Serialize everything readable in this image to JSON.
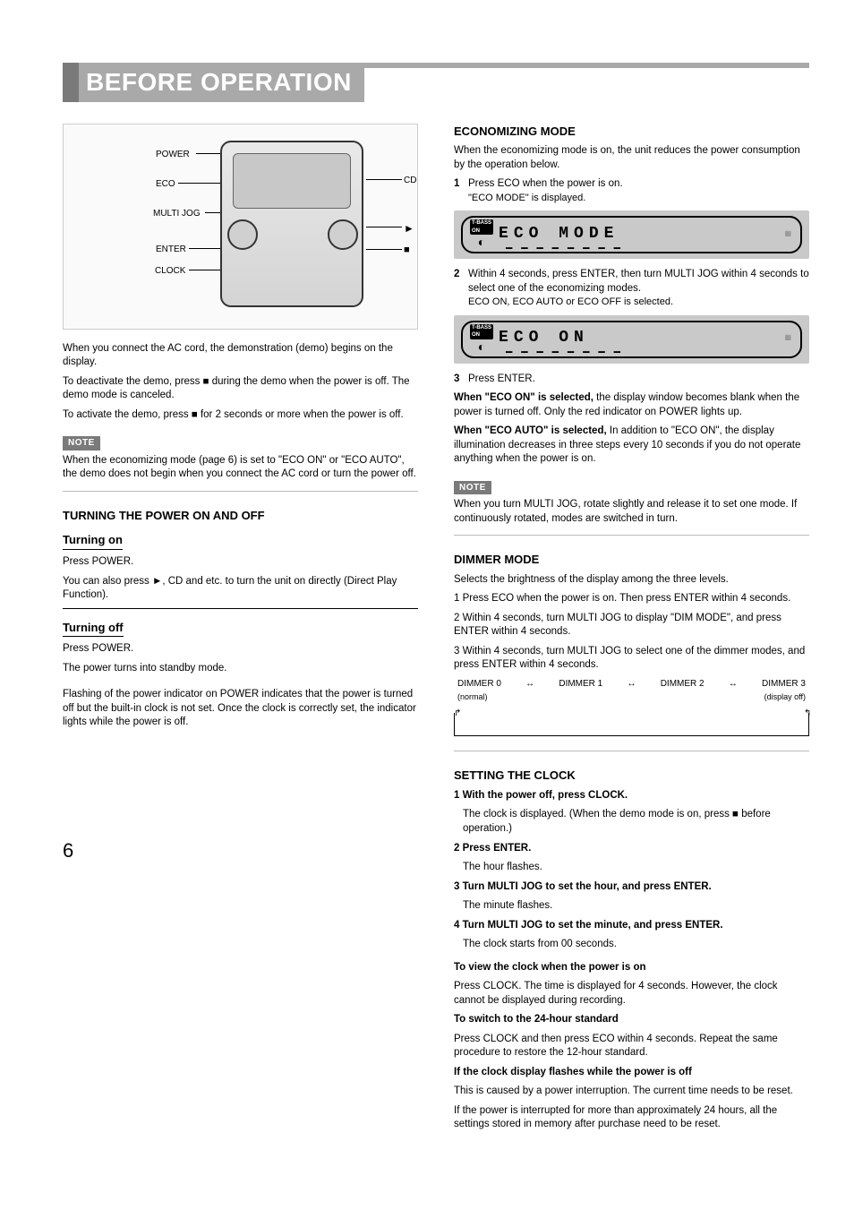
{
  "header": {
    "title": "BEFORE OPERATION"
  },
  "diagram": {
    "labels": {
      "power": "POWER",
      "eco": "ECO",
      "multijog": "MULTI JOG",
      "enter": "ENTER",
      "clock": "CLOCK",
      "cd": "CD",
      "play": "►",
      "stop": "■"
    }
  },
  "left": {
    "demo": {
      "p1": "When you connect the AC cord, the demonstration (demo) begins on the display.",
      "p2": "To deactivate the demo, press ■ during the demo when the power is off. The demo mode is canceled.",
      "p3": "To activate the demo, press ■ for 2 seconds or more when the power is off.",
      "note_label": "NOTE",
      "note_body": "When the economizing mode (page 6) is set to \"ECO ON\" or \"ECO AUTO\", the demo does not begin when you connect the AC cord or turn the power off."
    },
    "power_title": "TURNING THE POWER ON AND OFF",
    "turn_on": {
      "title": "Turning on",
      "body1": "Press POWER.",
      "body2": "You can also press ►, CD and etc. to turn the unit on directly (Direct Play Function)."
    },
    "turn_off": {
      "title": "Turning off",
      "body1": "Press POWER.",
      "body2": "The power turns into standby mode."
    },
    "flash": "Flashing of the power indicator on POWER indicates that the power is turned off but the built-in clock is not set. Once the clock is correctly set, the indicator lights while the power is off."
  },
  "right": {
    "eco_title": "ECONOMIZING MODE",
    "eco_intro": "When the economizing mode is on, the unit reduces the power consumption by the operation below.",
    "step1_n": "1",
    "step1_t": "Press ECO when the power is on.",
    "step1_sub": "\"ECO MODE\" is displayed.",
    "lcd1": "ECO MODE",
    "step2_n": "2",
    "step2_t": "Within 4 seconds, press ENTER, then turn MULTI JOG within 4 seconds to select one of the economizing modes.",
    "step2_sub": "ECO ON, ECO AUTO or ECO OFF is selected.",
    "lcd2": "ECO ON",
    "step3_n": "3",
    "step3_t": "Press ENTER.",
    "eco_on_t": "When \"ECO ON\" is selected,",
    "eco_on_b": "the display window becomes blank when the power is turned off. Only the red indicator on POWER lights up.",
    "eco_auto_t": "When \"ECO AUTO\" is selected,",
    "eco_auto_b": "In addition to \"ECO ON\", the display illumination decreases in three steps every 10 seconds if you do not operate anything when the power is on.",
    "note_label": "NOTE",
    "note_body": "When you turn MULTI JOG, rotate slightly and release it to set one mode. If continuously rotated, modes are switched in turn.",
    "dim_title": "DIMMER MODE",
    "dim_intro": "Selects the brightness of the display among the three levels.",
    "dim_s1": "1 Press ECO when the power is on. Then press ENTER within 4 seconds.",
    "dim_s2": "2 Within 4 seconds, turn MULTI JOG to display \"DIM MODE\", and press ENTER within 4 seconds.",
    "dim_s3": "3 Within 4 seconds, turn MULTI JOG to select one of the dimmer modes, and press ENTER within 4 seconds.",
    "dim_labels": [
      "DIMMER 0",
      "DIMMER 1",
      "DIMMER 2",
      "DIMMER 3"
    ],
    "dim_notes": [
      "(normal)",
      "",
      "",
      "(display off)"
    ],
    "clock_title": "SETTING THE CLOCK",
    "clock_s1": "1 With the power off, press CLOCK.",
    "clock_s1b": "The clock is displayed. (When the demo mode is on, press ■ before operation.)",
    "clock_s2": "2 Press ENTER.",
    "clock_s2b": "The hour flashes.",
    "clock_s3": "3 Turn MULTI JOG to set the hour, and press ENTER.",
    "clock_s3b": "The minute flashes.",
    "clock_s4": "4 Turn MULTI JOG to set the minute, and press ENTER.",
    "clock_s4b": "The clock starts from 00 seconds.",
    "clock_view": "To view the clock when the power is on",
    "clock_view_b": "Press CLOCK. The time is displayed for 4 seconds. However, the clock cannot be displayed during recording.",
    "clock_24": "To switch to the 24-hour standard",
    "clock_24_b": "Press CLOCK and then press ECO within 4 seconds. Repeat the same procedure to restore the 12-hour standard.",
    "clock_flash": "If the clock display flashes while the power is off",
    "clock_flash_b": "This is caused by a power interruption. The current time needs to be reset.",
    "clock_unplug": "If the power is interrupted for more than approximately 24 hours, all the settings stored in memory after purchase need to be reset."
  },
  "page": "6"
}
